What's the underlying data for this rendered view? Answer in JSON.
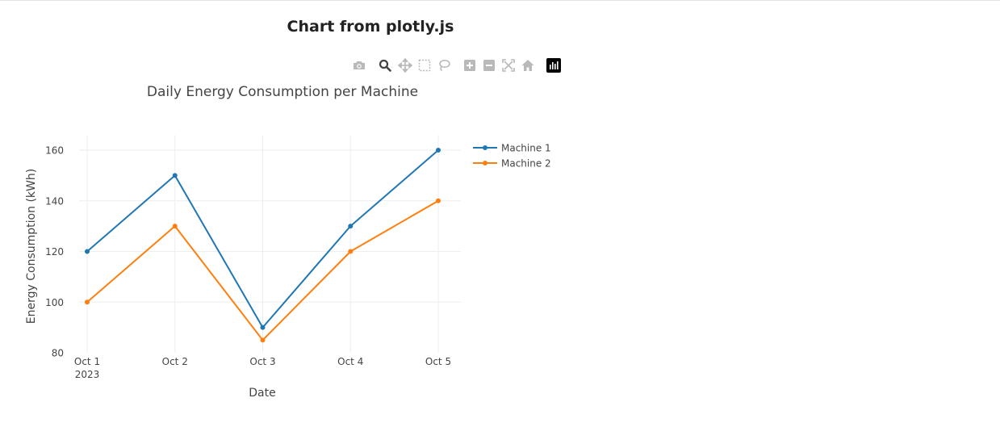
{
  "page": {
    "title": "Chart from plotly.js"
  },
  "modebar": {
    "buttons": [
      "camera-icon",
      "zoom-icon",
      "pan-icon",
      "box-select-icon",
      "lasso-select-icon",
      "zoom-in-icon",
      "zoom-out-icon",
      "autoscale-icon",
      "home-icon",
      "plotly-logo-icon"
    ]
  },
  "chart_data": {
    "type": "line",
    "title": "Daily Energy Consumption per Machine",
    "xlabel": "Date",
    "ylabel": "Energy Consumption (kWh)",
    "x": [
      "2023-10-01",
      "2023-10-02",
      "2023-10-03",
      "2023-10-04",
      "2023-10-05"
    ],
    "x_tick_labels": [
      "Oct 1",
      "Oct 2",
      "Oct 3",
      "Oct 4",
      "Oct 5"
    ],
    "x_tick_year": "2023",
    "y_ticks": [
      "80",
      "100",
      "120",
      "140",
      "160"
    ],
    "ylim": [
      80,
      166
    ],
    "grid": true,
    "legend_position": "top-right",
    "series": [
      {
        "name": "Machine 1",
        "color": "#1f77b4",
        "values": [
          120,
          150,
          90,
          130,
          160
        ]
      },
      {
        "name": "Machine 2",
        "color": "#ff7f0e",
        "values": [
          100,
          130,
          85,
          120,
          140
        ]
      }
    ]
  }
}
